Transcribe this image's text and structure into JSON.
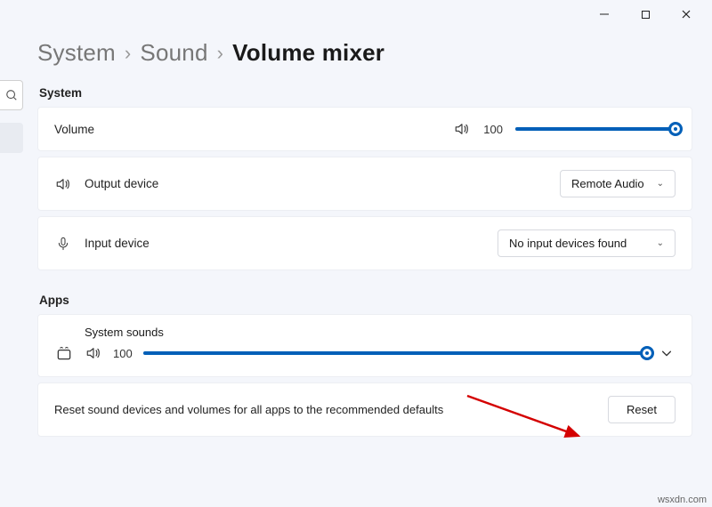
{
  "titlebar": {
    "minimize": "–",
    "maximize": "□",
    "close": "✕"
  },
  "breadcrumb": {
    "a": "System",
    "b": "Sound",
    "c": "Volume mixer"
  },
  "sections": {
    "system": "System",
    "apps": "Apps"
  },
  "system": {
    "volume": {
      "label": "Volume",
      "value": "100",
      "percent": 100
    },
    "output": {
      "label": "Output device",
      "selected": "Remote Audio"
    },
    "input": {
      "label": "Input device",
      "selected": "No input devices found"
    }
  },
  "apps": {
    "system_sounds": {
      "label": "System sounds",
      "value": "100",
      "percent": 100
    }
  },
  "reset": {
    "text": "Reset sound devices and volumes for all apps to the recommended defaults",
    "button": "Reset"
  },
  "watermark": "wsxdn.com"
}
